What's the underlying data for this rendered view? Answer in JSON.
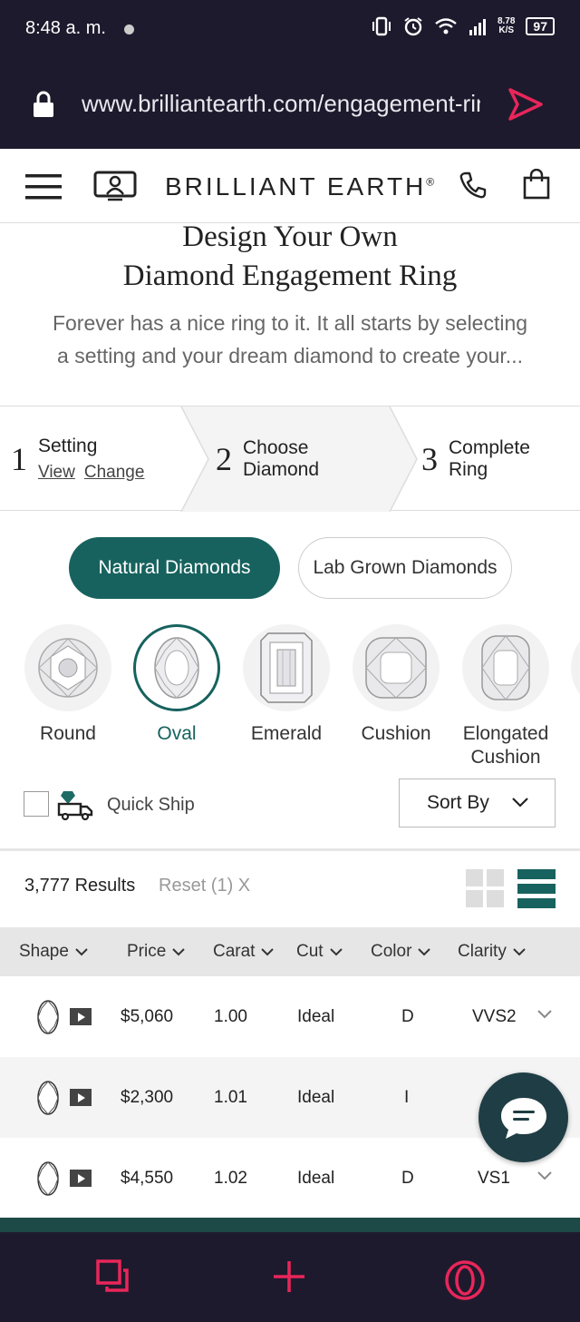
{
  "status_bar": {
    "time": "8:48 a. m.",
    "speed_top": "8.78",
    "speed_bottom": "K/S",
    "battery": "97"
  },
  "browser": {
    "url": "www.brilliantearth.com/engagement-rings/design-your-own"
  },
  "site_header": {
    "brand": "BRILLIANT EARTH",
    "brand_mark": "®"
  },
  "hero": {
    "title_line1": "Design Your Own",
    "title_line2": "Diamond Engagement Ring",
    "subtitle_line1": "Forever has a nice ring to it. It all starts by selecting",
    "subtitle_line2": "a setting and your dream diamond to create your..."
  },
  "steps": [
    {
      "number": "1",
      "label": "Setting",
      "link_view": "View",
      "link_change": "Change"
    },
    {
      "number": "2",
      "label_line1": "Choose",
      "label_line2": "Diamond"
    },
    {
      "number": "3",
      "label_line1": "Complete",
      "label_line2": "Ring"
    }
  ],
  "diamond_type": {
    "natural": "Natural Diamonds",
    "lab": "Lab Grown Diamonds"
  },
  "shapes": [
    {
      "name": "Round"
    },
    {
      "name": "Oval"
    },
    {
      "name": "Emerald"
    },
    {
      "name": "Cushion"
    },
    {
      "name_line1": "Elongated",
      "name_line2": "Cushion"
    }
  ],
  "filters": {
    "quick_ship": "Quick Ship",
    "sort_by": "Sort By"
  },
  "results": {
    "count": "3,777 Results",
    "reset": "Reset (1) X"
  },
  "table": {
    "headers": [
      "Shape",
      "Price",
      "Carat",
      "Cut",
      "Color",
      "Clarity"
    ],
    "rows": [
      {
        "price": "$5,060",
        "carat": "1.00",
        "cut": "Ideal",
        "color": "D",
        "clarity": "VVS2"
      },
      {
        "price": "$2,300",
        "carat": "1.01",
        "cut": "Ideal",
        "color": "I",
        "clarity": ""
      },
      {
        "price": "$4,550",
        "carat": "1.02",
        "cut": "Ideal",
        "color": "D",
        "clarity": "VS1"
      }
    ]
  },
  "colors": {
    "accent": "#17625e",
    "dark_bar": "#1e1a2d",
    "opera_red": "#e8265a"
  }
}
